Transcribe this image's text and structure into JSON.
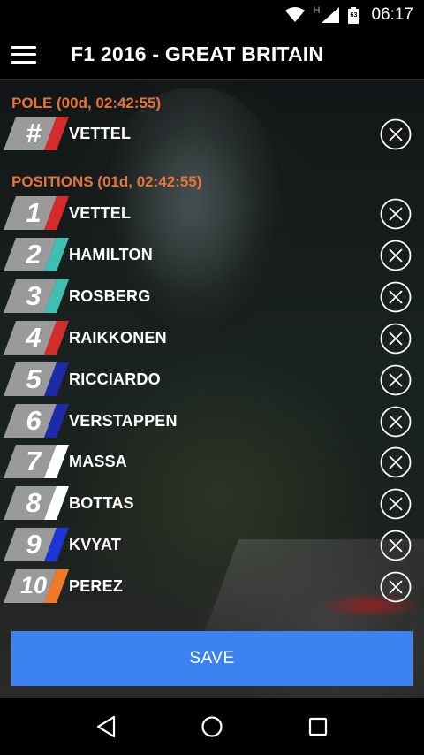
{
  "status_bar": {
    "time": "06:17",
    "battery_level": "63",
    "network_label": "H"
  },
  "app_bar": {
    "title": "F1 2016 - GREAT BRITAIN",
    "menu_icon": "hamburger-menu-icon"
  },
  "pole": {
    "label": "POLE (00d, 02:42:55)",
    "badge": "#",
    "badge_color": "#d62b2b",
    "driver": "VETTEL"
  },
  "positions": {
    "label": "POSITIONS (01d, 02:42:55)",
    "items": [
      {
        "num": "1",
        "driver": "VETTEL",
        "color": "#d62b2b"
      },
      {
        "num": "2",
        "driver": "HAMILTON",
        "color": "#3fbfb0"
      },
      {
        "num": "3",
        "driver": "ROSBERG",
        "color": "#3fbfb0"
      },
      {
        "num": "4",
        "driver": "RAIKKONEN",
        "color": "#d62b2b"
      },
      {
        "num": "5",
        "driver": "RICCIARDO",
        "color": "#1e2aa8"
      },
      {
        "num": "6",
        "driver": "VERSTAPPEN",
        "color": "#1e2aa8"
      },
      {
        "num": "7",
        "driver": "MASSA",
        "color": "#ffffff"
      },
      {
        "num": "8",
        "driver": "BOTTAS",
        "color": "#ffffff"
      },
      {
        "num": "9",
        "driver": "KVYAT",
        "color": "#1e35d6"
      },
      {
        "num": "10",
        "driver": "PEREZ",
        "color": "#f07a2a"
      }
    ]
  },
  "save_label": "SAVE",
  "colors": {
    "accent": "#3c83f1",
    "section_label": "#e8733a"
  }
}
